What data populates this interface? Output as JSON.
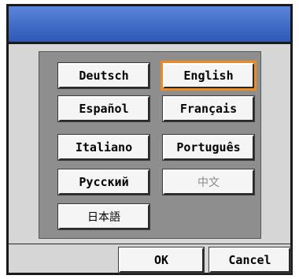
{
  "window": {
    "title": ""
  },
  "languages": [
    {
      "label": "Deutsch"
    },
    {
      "label": "English",
      "selected": true
    },
    {
      "label": "Español"
    },
    {
      "label": "Français"
    },
    {
      "label": "Italiano"
    },
    {
      "label": "Português"
    },
    {
      "label": "Русский"
    },
    {
      "label": "中文",
      "disabled": true
    },
    {
      "label": "日本語"
    }
  ],
  "footer": {
    "ok_label": "OK",
    "cancel_label": "Cancel"
  },
  "colors": {
    "titlebar_top": "#5b86d8",
    "titlebar_bottom": "#2e59b6",
    "selection_outline": "#ee8a24",
    "panel_bg": "#8e8e8e",
    "dialog_bg": "#d6d6d6"
  }
}
